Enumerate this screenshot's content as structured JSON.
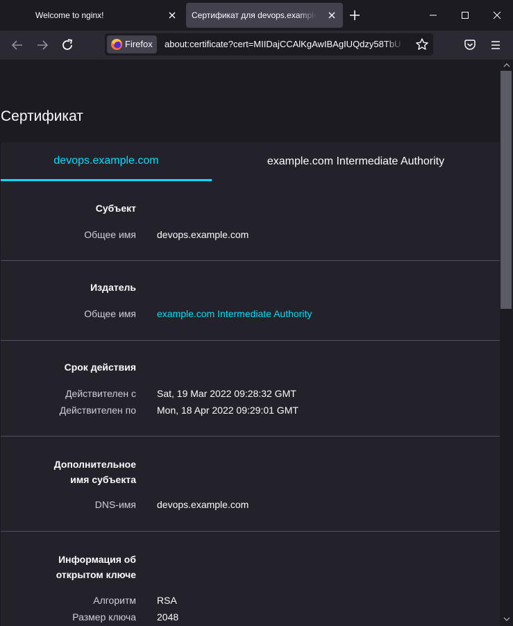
{
  "browser": {
    "tabs": [
      {
        "title": "Welcome to nginx!"
      },
      {
        "title": "Сертификат для devops.example.com"
      }
    ],
    "identity_label": "Firefox",
    "url": "about:certificate?cert=MIIDajCCAlKgAwIBAgIUQdzy58TbU"
  },
  "page": {
    "title": "Сертификат",
    "cert_tabs": [
      "devops.example.com",
      "example.com Intermediate Authority"
    ],
    "sections": {
      "subject": {
        "title": "Субъект",
        "rows": [
          {
            "label": "Общее имя",
            "value": "devops.example.com"
          }
        ]
      },
      "issuer": {
        "title": "Издатель",
        "rows": [
          {
            "label": "Общее имя",
            "value": "example.com Intermediate Authority"
          }
        ]
      },
      "validity": {
        "title": "Срок действия",
        "rows": [
          {
            "label": "Действителен с",
            "value": "Sat, 19 Mar 2022 09:28:32 GMT"
          },
          {
            "label": "Действителен по",
            "value": "Mon, 18 Apr 2022 09:29:01 GMT"
          }
        ]
      },
      "san": {
        "title_line1": "Дополнительное",
        "title_line2": "имя субъекта",
        "rows": [
          {
            "label": "DNS-имя",
            "value": "devops.example.com"
          }
        ]
      },
      "pubkey": {
        "title_line1": "Информация об",
        "title_line2": "открытом ключе",
        "rows": [
          {
            "label": "Алгоритм",
            "value": "RSA"
          },
          {
            "label": "Размер ключа",
            "value": "2048"
          }
        ]
      }
    }
  },
  "colors": {
    "accent": "#00ddff",
    "page_bg": "#1c1b22",
    "panel_bg": "#23222b",
    "chrome_bg": "#2b2a33",
    "selected_tab": "#42414d"
  }
}
